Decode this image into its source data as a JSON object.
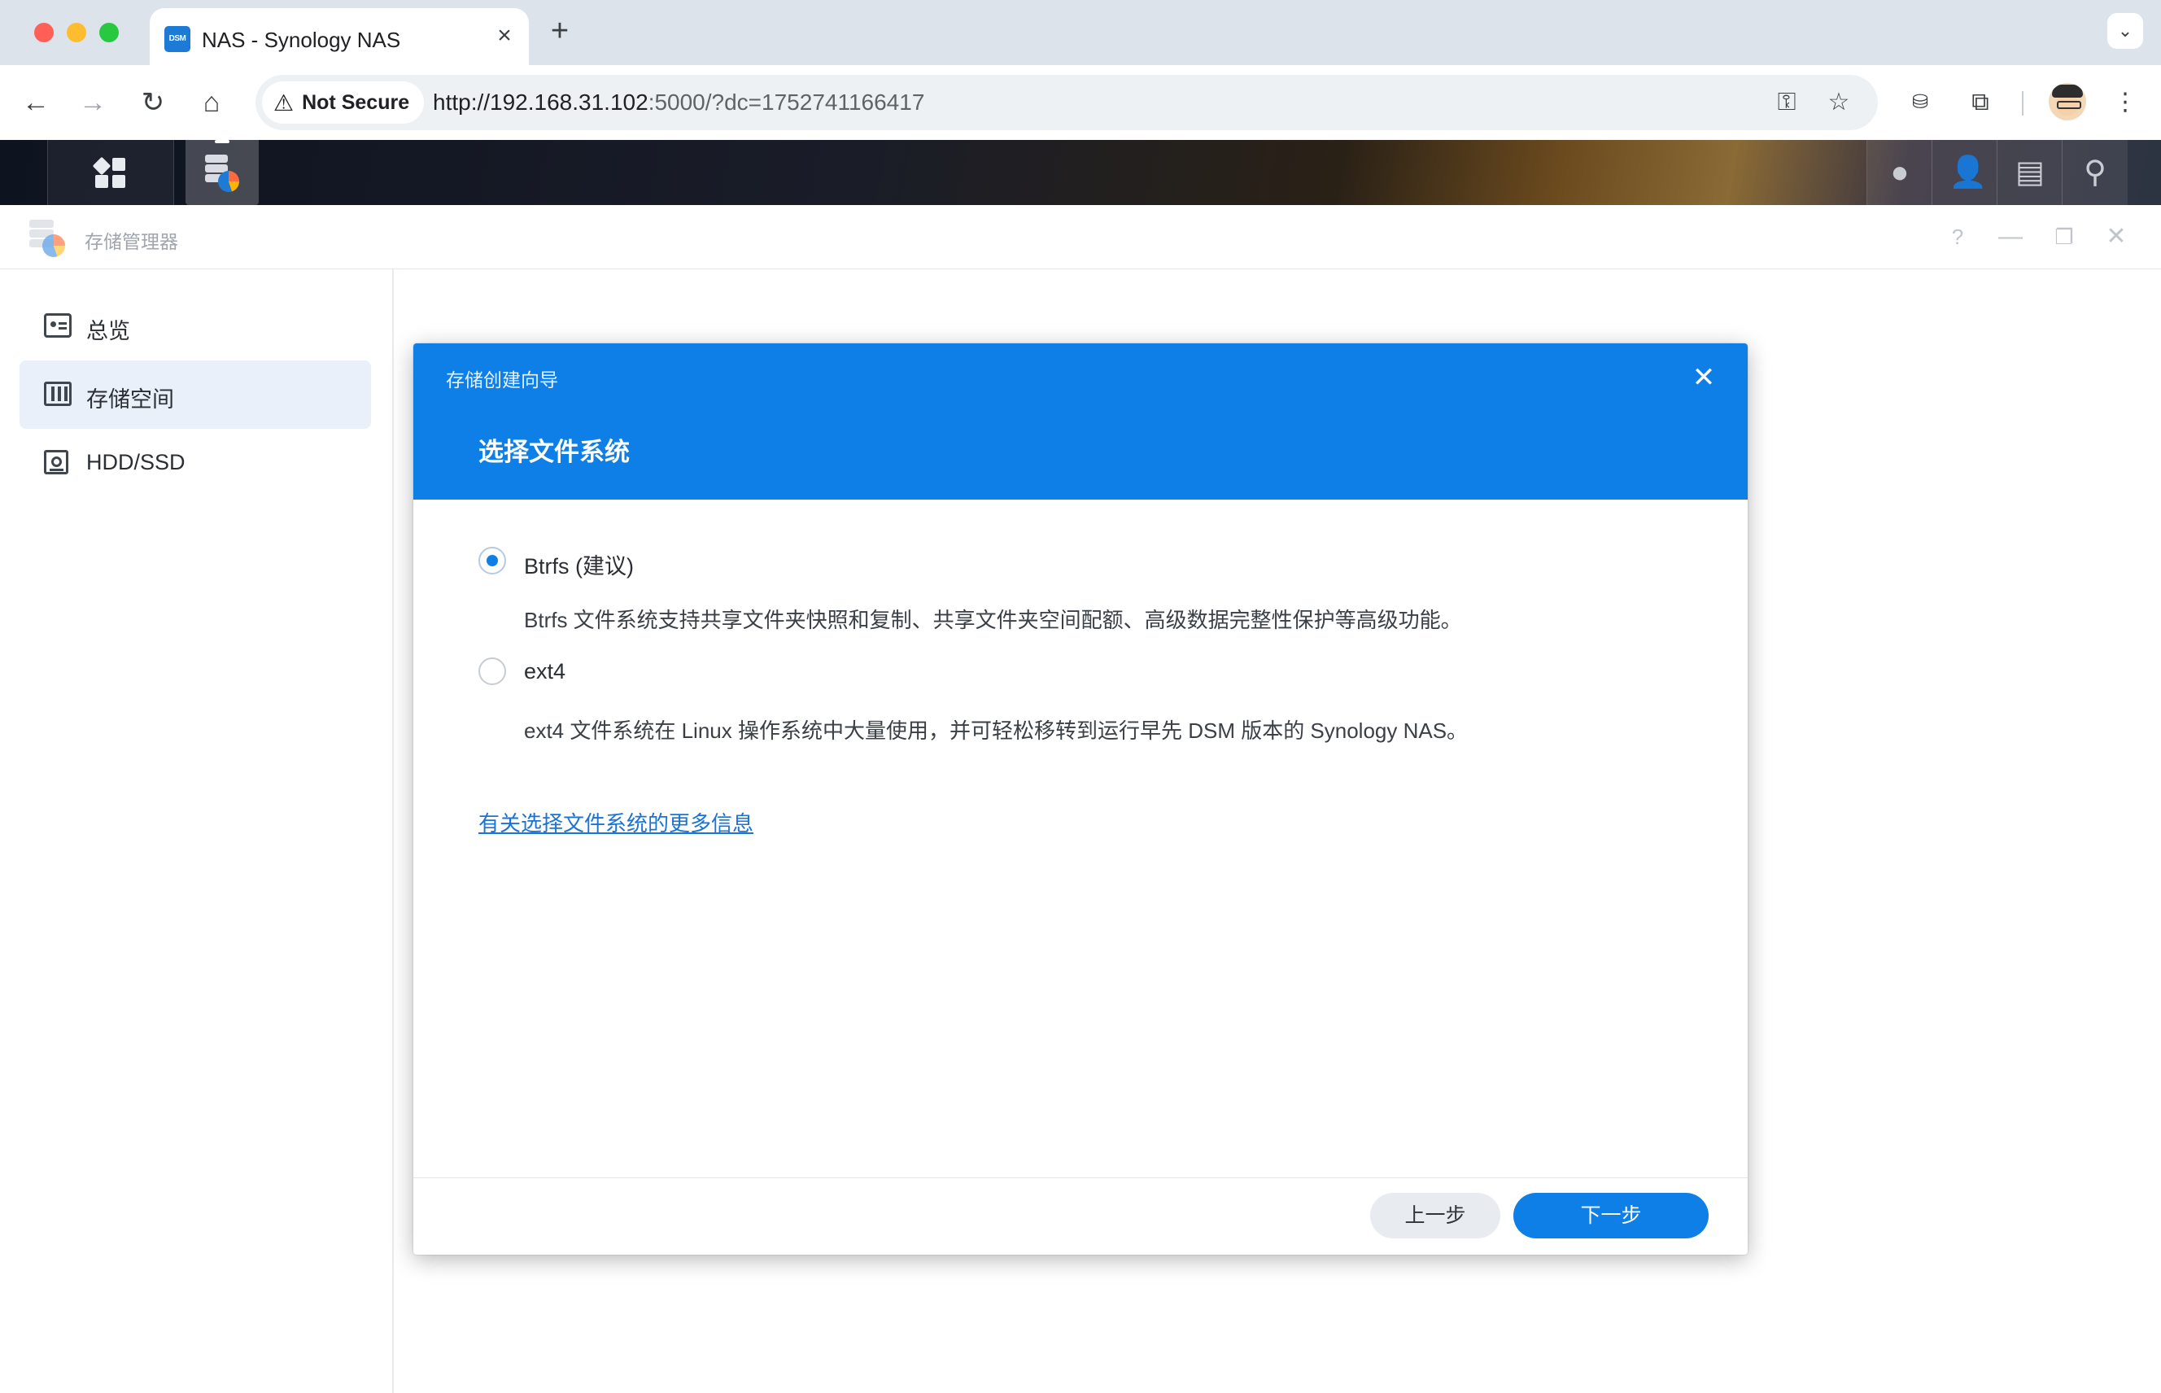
{
  "browser": {
    "tab_title": "NAS - Synology NAS",
    "tab_favicon_text": "DSM",
    "security_label": "Not Secure",
    "url_host": "http://192.168.31.102",
    "url_rest": ":5000/?dc=1752741166417"
  },
  "window": {
    "title": "存储管理器",
    "help_icon": "?"
  },
  "sidebar": {
    "items": [
      {
        "label": "总览",
        "icon": "overview-icon",
        "active": false
      },
      {
        "label": "存储空间",
        "icon": "storage-pool-icon",
        "active": true
      },
      {
        "label": "HDD/SSD",
        "icon": "hdd-icon",
        "active": false
      }
    ]
  },
  "wizard": {
    "title": "存储创建向导",
    "step_title": "选择文件系统",
    "options": [
      {
        "label": "Btrfs (建议)",
        "description": "Btrfs 文件系统支持共享文件夹快照和复制、共享文件夹空间配额、高级数据完整性保护等高级功能。",
        "selected": true
      },
      {
        "label": "ext4",
        "description": "ext4 文件系统在 Linux 操作系统中大量使用，并可轻松移转到运行早先 DSM 版本的 Synology NAS。",
        "selected": false
      }
    ],
    "more_info_link": "有关选择文件系统的更多信息",
    "prev_button": "上一步",
    "next_button": "下一步"
  },
  "colors": {
    "accent": "#0e7fe7",
    "sidebar_active": "#e9f0fa",
    "link": "#1a73d6"
  }
}
